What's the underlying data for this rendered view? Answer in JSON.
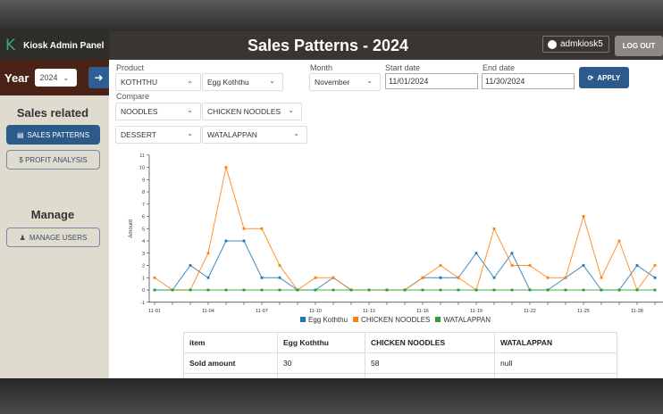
{
  "brand": {
    "logo": "K",
    "name": "Kiosk Admin Panel"
  },
  "header": {
    "title": "Sales Patterns - 2024",
    "user": "admkiosk5",
    "logout": "LOG OUT"
  },
  "year": {
    "label": "Year",
    "value": "2024"
  },
  "sidebar": {
    "sales_heading": "Sales related",
    "sales_patterns": "SALES PATTERNS",
    "profit_analysis": "$ PROFIT ANALYSIS",
    "manage_heading": "Manage",
    "manage_users": "MANAGE USERS"
  },
  "filters": {
    "product_label": "Product",
    "product_category": "KOTHTHU",
    "product_item": "Egg Koththu",
    "compare_label": "Compare",
    "compare1_category": "NOODLES",
    "compare1_item": "CHICKEN NOODLES",
    "compare2_category": "DESSERT",
    "compare2_item": "WATALAPPAN",
    "month_label": "Month",
    "month": "November",
    "start_label": "Start date",
    "start": "11/01/2024",
    "end_label": "End date",
    "end": "11/30/2024",
    "apply": "APPLY"
  },
  "chart_data": {
    "type": "line",
    "ylabel": "Amount",
    "ylim": [
      -1,
      11
    ],
    "x": [
      "11-01",
      "11-02",
      "11-03",
      "11-04",
      "11-05",
      "11-06",
      "11-07",
      "11-08",
      "11-09",
      "11-10",
      "11-11",
      "11-12",
      "11-13",
      "11-14",
      "11-15",
      "11-16",
      "11-17",
      "11-18",
      "11-19",
      "11-20",
      "11-21",
      "11-22",
      "11-23",
      "11-24",
      "11-25",
      "11-26",
      "11-27",
      "11-28",
      "11-29"
    ],
    "xticks": [
      "11-01",
      "11-04",
      "11-07",
      "11-10",
      "11-13",
      "11-16",
      "11-19",
      "11-22",
      "11-25",
      "11-28"
    ],
    "yticks": [
      -1,
      0,
      1,
      2,
      3,
      4,
      5,
      6,
      7,
      8,
      9,
      10,
      11
    ],
    "series": [
      {
        "name": "Egg Koththu",
        "color": "#1f77b4",
        "values": [
          0,
          0,
          2,
          1,
          4,
          4,
          1,
          1,
          0,
          0,
          1,
          0,
          0,
          0,
          0,
          1,
          1,
          1,
          3,
          1,
          3,
          0,
          0,
          1,
          2,
          0,
          0,
          2,
          1
        ]
      },
      {
        "name": "CHICKEN NOODLES",
        "color": "#ff7f0e",
        "values": [
          1,
          0,
          0,
          3,
          10,
          5,
          5,
          2,
          0,
          1,
          1,
          0,
          0,
          0,
          0,
          1,
          2,
          1,
          0,
          5,
          2,
          2,
          1,
          1,
          6,
          1,
          4,
          0,
          2
        ]
      },
      {
        "name": "WATALAPPAN",
        "color": "#2ca02c",
        "values": [
          0,
          0,
          0,
          0,
          0,
          0,
          0,
          0,
          0,
          0,
          0,
          0,
          0,
          0,
          0,
          0,
          0,
          0,
          0,
          0,
          0,
          0,
          0,
          0,
          0,
          0,
          0,
          0,
          0
        ]
      }
    ],
    "legend": "bottom"
  },
  "table": {
    "headers": [
      "item",
      "Egg Koththu",
      "CHICKEN NOODLES",
      "WATALAPPAN"
    ],
    "rows": [
      [
        "Sold amount",
        "30",
        "58",
        "null"
      ]
    ]
  }
}
